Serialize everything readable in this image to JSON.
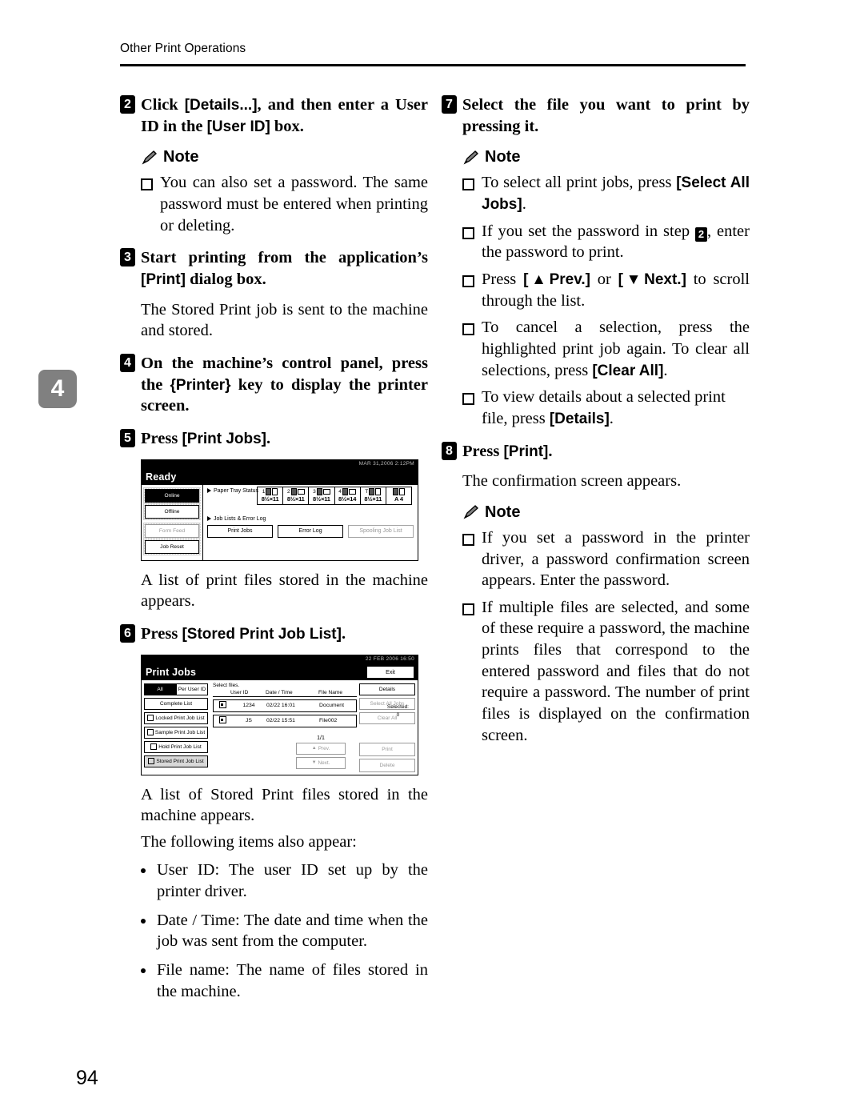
{
  "page": {
    "running_head": "Other Print Operations",
    "chapter_tab": "4",
    "folio": "94"
  },
  "left_column": {
    "step2": {
      "num": "2",
      "text_parts": [
        "Click ",
        "[Details...]",
        ", and then enter a User ID in the ",
        "[User ID]",
        " box."
      ],
      "note_label": "Note",
      "notes": [
        "You can also set a password. The same password must be entered when printing or deleting."
      ]
    },
    "step3": {
      "num": "3",
      "text_parts": [
        "Start printing from the application’s ",
        "[Print]",
        " dialog box."
      ],
      "body": "The Stored Print job is sent to the machine and stored."
    },
    "step4": {
      "num": "4",
      "text_parts": [
        "On the machine’s control panel, press the ",
        "{Printer}",
        " key to display the printer screen."
      ]
    },
    "step5": {
      "num": "5",
      "text_parts": [
        "Press ",
        "[Print Jobs]",
        "."
      ],
      "body": "A list of print files stored in the machine appears."
    },
    "step6": {
      "num": "6",
      "text_parts": [
        "Press ",
        "[Stored Print Job List]",
        "."
      ],
      "body1": "A list of Stored Print files stored in the machine appears.",
      "body2": "The following items also appear:",
      "bullets": [
        "User ID: The user ID set up by the printer driver.",
        "Date / Time: The date and time when the job was sent from the computer.",
        "File name: The name of files stored in the machine."
      ]
    }
  },
  "right_column": {
    "step7": {
      "num": "7",
      "text": "Select the file you want to print by pressing it.",
      "note_label": "Note",
      "notes": [
        {
          "parts": [
            "To select all print jobs, press ",
            "[Select All Jobs]",
            "."
          ]
        },
        {
          "parts": [
            "If you set the password in step ",
            "2",
            ", enter the password to print."
          ]
        },
        {
          "parts": [
            "Press ",
            "[▲Prev.]",
            " or ",
            "[▼Next.]",
            " to scroll through the list."
          ]
        },
        {
          "parts": [
            "To cancel a selection, press the highlighted print job again. To clear all selections, press ",
            "[Clear All]",
            "."
          ]
        },
        {
          "parts": [
            "To view details about a selected print file, press ",
            "[Details]",
            "."
          ]
        }
      ]
    },
    "step8": {
      "num": "8",
      "text_parts": [
        "Press ",
        "[Print]",
        "."
      ],
      "body": "The confirmation screen appears.",
      "note_label": "Note",
      "notes": [
        "If you set a password in the printer driver, a password confirmation screen appears. Enter the password.",
        "If multiple files are selected, and some of these require a password, the machine prints files that correspond to the entered password and files that do not require a password. The number of print files is displayed on the confirmation screen."
      ]
    }
  },
  "figure_ready": {
    "datetime": "MAR  31,2006  2:12PM",
    "title": "Ready",
    "left_buttons": [
      {
        "label": "Online",
        "state": "selected"
      },
      {
        "label": "Offline",
        "state": "normal"
      },
      {
        "label": "Form Feed",
        "state": "dim"
      },
      {
        "label": "Job Reset",
        "state": "normal"
      }
    ],
    "paper_tray_label": "Paper Tray Status",
    "trays": [
      {
        "id": "1",
        "size": "8½×11"
      },
      {
        "id": "2",
        "size": "8½×11"
      },
      {
        "id": "3",
        "size": "8½×11"
      },
      {
        "id": "4",
        "size": "8½×14"
      },
      {
        "id": "T",
        "size": "8½×11"
      },
      {
        "id": "",
        "size": "A 4"
      }
    ],
    "joblists_label": "Job Lists & Error Log",
    "bottom_buttons": [
      {
        "label": "Print Jobs",
        "state": "normal"
      },
      {
        "label": "Error Log",
        "state": "normal"
      },
      {
        "label": "Spooling Job List",
        "state": "dim"
      }
    ]
  },
  "figure_printjobs": {
    "datetime": "22 FEB  2006 16:50",
    "title": "Print Jobs",
    "exit_label": "Exit",
    "filter_buttons": [
      {
        "label": "All",
        "state": "selected"
      },
      {
        "label": "Per User ID",
        "state": "normal"
      }
    ],
    "list_buttons": [
      {
        "label": "Complete List",
        "state": "normal"
      },
      {
        "label": "Locked Print Job List",
        "state": "normal"
      },
      {
        "label": "Sample Print Job List",
        "state": "normal"
      },
      {
        "label": "Hold Print Job List",
        "state": "normal"
      },
      {
        "label": "Stored Print Job List",
        "state": "highlighted"
      }
    ],
    "select_files_label": "Select files.",
    "columns": [
      "User ID",
      "Date / Time",
      "File Name"
    ],
    "rows": [
      {
        "user_id": "1234",
        "datetime": "02/22 16:01",
        "file_name": "Document"
      },
      {
        "user_id": "JS",
        "datetime": "02/22 15:51",
        "file_name": "File002"
      }
    ],
    "selected_label": "Selected:",
    "selected_count": "0",
    "page_indicator": "1/1",
    "prev_label": "Prev.",
    "next_label": "Next.",
    "right_buttons": [
      {
        "label": "Details",
        "state": "normal"
      },
      {
        "label": "Select All Jobs",
        "state": "dim"
      },
      {
        "label": "Clear All",
        "state": "dim"
      },
      {
        "label": "Print",
        "state": "dim"
      },
      {
        "label": "Delete",
        "state": "dim"
      }
    ]
  }
}
